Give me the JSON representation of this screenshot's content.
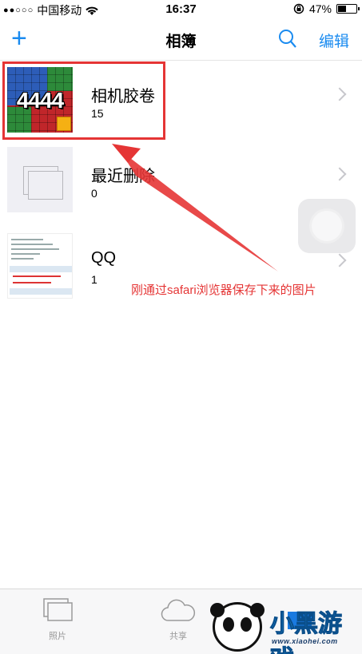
{
  "status_bar": {
    "signal": "●●○○○",
    "carrier": "中国移动",
    "time": "16:37",
    "battery_percent": "47%",
    "battery_level": 0.47
  },
  "nav": {
    "add_label": "+",
    "title": "相簿",
    "edit_label": "编辑"
  },
  "albums": [
    {
      "name": "相机胶卷",
      "count": "15",
      "thumb_text": "4444"
    },
    {
      "name": "最近删除",
      "count": "0"
    },
    {
      "name": "QQ",
      "count": "1"
    }
  ],
  "annotation": {
    "text": "刚通过safari浏览器保存下来的图片",
    "color": "#e53535"
  },
  "tabs": [
    {
      "label": "照片",
      "icon": "photos-icon"
    },
    {
      "label": "共享",
      "icon": "cloud-icon"
    }
  ],
  "watermark": {
    "text": "小黑游戏",
    "url": "www.xiaohei.com"
  },
  "colors": {
    "accent": "#1a8bf0",
    "annotation_red": "#e53535",
    "tab_inactive": "#9a9a9a"
  }
}
